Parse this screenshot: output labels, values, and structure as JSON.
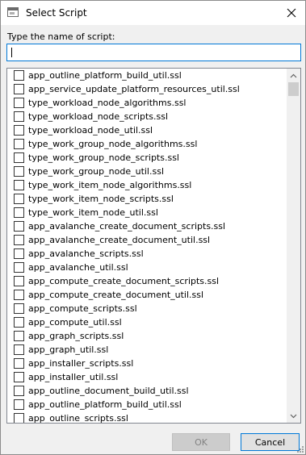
{
  "window": {
    "title": "Select Script"
  },
  "prompt_label": "Type the name of script:",
  "search": {
    "value": "",
    "placeholder": ""
  },
  "items": [
    "app_outline_platform_build_util.ssl",
    "app_service_update_platform_resources_util.ssl",
    "type_workload_node_algorithms.ssl",
    "type_workload_node_scripts.ssl",
    "type_workload_node_util.ssl",
    "type_work_group_node_algorithms.ssl",
    "type_work_group_node_scripts.ssl",
    "type_work_group_node_util.ssl",
    "type_work_item_node_algorithms.ssl",
    "type_work_item_node_scripts.ssl",
    "type_work_item_node_util.ssl",
    "app_avalanche_create_document_scripts.ssl",
    "app_avalanche_create_document_util.ssl",
    "app_avalanche_scripts.ssl",
    "app_avalanche_util.ssl",
    "app_compute_create_document_scripts.ssl",
    "app_compute_create_document_util.ssl",
    "app_compute_scripts.ssl",
    "app_compute_util.ssl",
    "app_graph_scripts.ssl",
    "app_graph_util.ssl",
    "app_installer_scripts.ssl",
    "app_installer_util.ssl",
    "app_outline_document_build_util.ssl",
    "app_outline_platform_build_util.ssl",
    "app_outline_scripts.ssl"
  ],
  "buttons": {
    "ok": "OK",
    "cancel": "Cancel"
  },
  "colors": {
    "accent": "#0078d7",
    "window_bg": "#f0f0f0",
    "disabled_text": "#838383"
  },
  "icons": {
    "app": "window-icon",
    "close": "close-icon",
    "scroll_up": "chevron-up-icon",
    "scroll_down": "chevron-down-icon",
    "resize": "resize-grip-icon"
  }
}
